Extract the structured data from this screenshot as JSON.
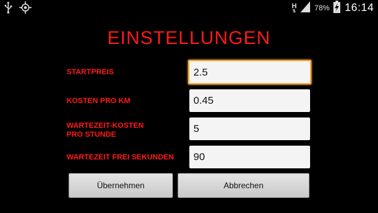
{
  "status_bar": {
    "battery_percent": "78%",
    "time": "16:14",
    "network_label": "H",
    "icons": [
      "usb-icon",
      "gps-icon",
      "network-h-icon",
      "signal-icon",
      "battery-charging-icon"
    ]
  },
  "page": {
    "title": "EINSTELLUNGEN",
    "accent_color": "#ff1a1a",
    "focus_color": "#f5a133"
  },
  "form": {
    "fields": [
      {
        "label": "STARTPREIS",
        "value": "2.5"
      },
      {
        "label": "KOSTEN PRO KM",
        "value": "0.45"
      },
      {
        "label": "WARTEZEIT-KOSTEN\nPRO STUNDE",
        "value": "5"
      },
      {
        "label": "WARTEZEIT FREI SEKUNDEN",
        "value": "90"
      }
    ]
  },
  "buttons": {
    "apply_label": "Übernehmen",
    "cancel_label": "Abbrechen"
  }
}
